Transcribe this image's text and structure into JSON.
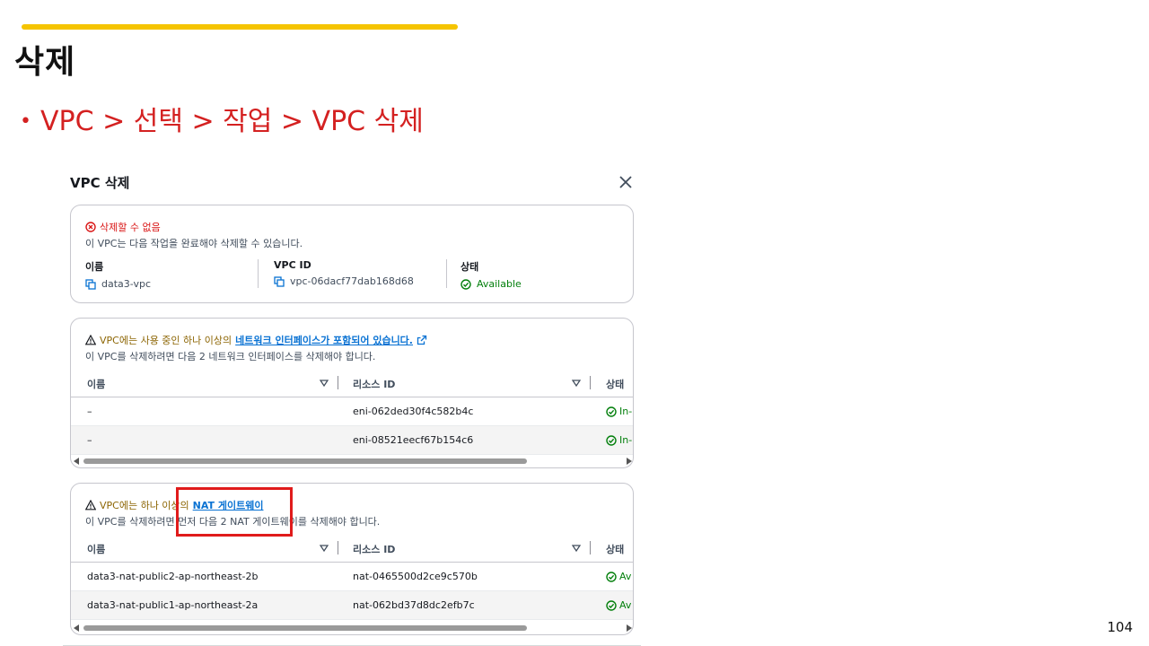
{
  "slide": {
    "title": "삭제",
    "bullet": "VPC > 선택 > 작업 > VPC 삭제",
    "page_number": "104",
    "colors": {
      "accent_bar": "#f5c400",
      "bullet_text": "#d42121",
      "highlight": "#e01b1b"
    }
  },
  "dialog": {
    "title": "VPC 삭제",
    "close_icon": "close-icon",
    "summary": {
      "error_title": "삭제할 수 없음",
      "error_desc": "이 VPC는 다음 작업을 완료해야 삭제할 수 있습니다.",
      "fields": [
        {
          "label": "이름",
          "value": "data3-vpc",
          "icon": "copy-icon"
        },
        {
          "label": "VPC ID",
          "value": "vpc-06dacf77dab168d68",
          "icon": "copy-icon"
        },
        {
          "label": "상태",
          "value": "Available",
          "icon": "check-circle-icon"
        }
      ]
    },
    "eni_section": {
      "warning_prefix": "VPC에는 사용 중인 하나 이상의",
      "warning_link": "네트워크 인터페이스가 포함되어 있습니다.",
      "desc": "이 VPC를 삭제하려면 다음 2 네트워크 인터페이스를 삭제해야 합니다.",
      "columns": [
        "이름",
        "리소스 ID",
        "상태"
      ],
      "rows": [
        {
          "name": "–",
          "id": "eni-062ded30f4c582b4c",
          "status": "In-"
        },
        {
          "name": "–",
          "id": "eni-08521eecf67b154c6",
          "status": "In-"
        }
      ]
    },
    "nat_section": {
      "warning_prefix": "VPC에는 하나 이상의",
      "warning_link": "NAT 게이트웨이",
      "desc": "이 VPC를 삭제하려면 먼저 다음 2 NAT 게이트웨이를 삭제해야 합니다.",
      "columns": [
        "이름",
        "리소스 ID",
        "상태"
      ],
      "rows": [
        {
          "name": "data3-nat-public2-ap-northeast-2b",
          "id": "nat-0465500d2ce9c570b",
          "status": "Av"
        },
        {
          "name": "data3-nat-public1-ap-northeast-2a",
          "id": "nat-062bd37d8dc2efb7c",
          "status": "Av"
        }
      ]
    }
  }
}
